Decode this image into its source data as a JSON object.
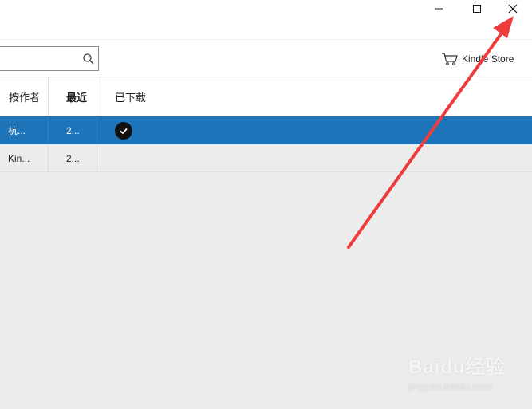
{
  "window": {
    "minimize_icon": "minimize-icon",
    "maximize_icon": "maximize-icon",
    "close_icon": "close-icon"
  },
  "toolbar": {
    "search_value": "",
    "search_icon": "search-icon",
    "store_label": "Kindle Store",
    "store_icon": "cart-icon"
  },
  "table": {
    "columns": [
      {
        "label": "按作者"
      },
      {
        "label": "最近"
      },
      {
        "label": "已下载"
      }
    ],
    "rows": [
      {
        "author": "杭...",
        "recent": "2...",
        "downloaded": true,
        "selected": true
      },
      {
        "author": "Kin...",
        "recent": "2...",
        "downloaded": false,
        "selected": false
      }
    ]
  },
  "colors": {
    "selected_row": "#1e74b8",
    "background": "#ececec",
    "annotation_arrow": "#ee3b3b"
  },
  "watermark": {
    "brand": "Baidu经验",
    "url": "jingyan.baidu.com"
  }
}
